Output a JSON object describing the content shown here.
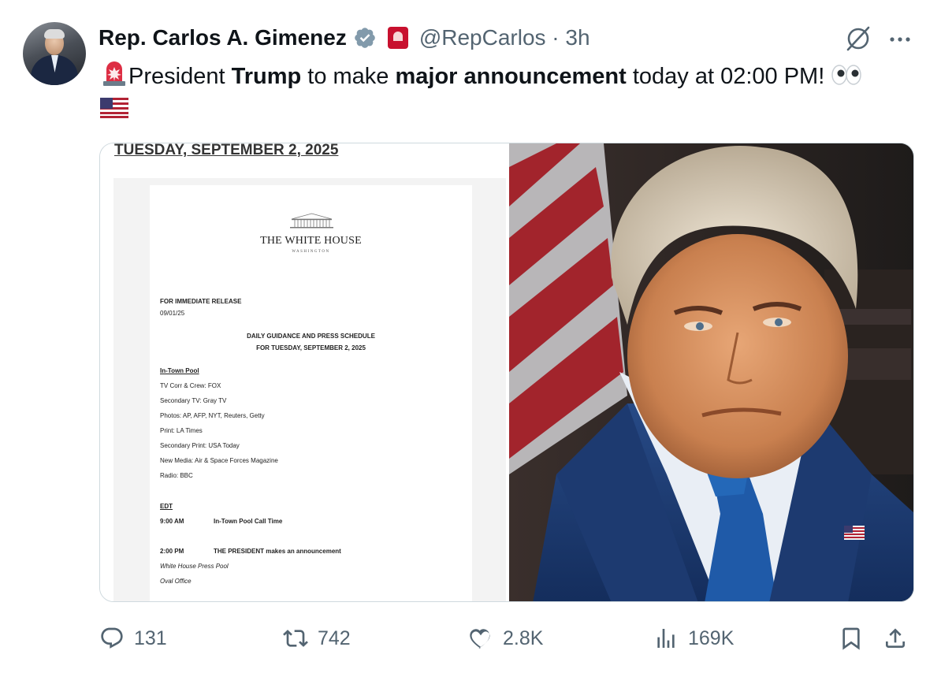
{
  "author": {
    "name": "Rep. Carlos A. Gimenez",
    "handle": "@RepCarlos",
    "time_sep": " · ",
    "time": "3h",
    "verified_icon": "verified-badge-icon",
    "affiliation_badge": "congress-badge-icon"
  },
  "tweet": {
    "pre": "President ",
    "bold1": "Trump",
    "mid": " to make ",
    "bold2": "major announcement",
    "post": " today at 02:00 PM! "
  },
  "document": {
    "date_header": "TUESDAY, SEPTEMBER 2, 2025",
    "org": "THE WHITE HOUSE",
    "org_sub": "WASHINGTON",
    "release": "FOR IMMEDIATE RELEASE",
    "release_date": "09/01/25",
    "schedule_title": "DAILY GUIDANCE AND PRESS SCHEDULE",
    "schedule_date": "FOR TUESDAY, SEPTEMBER 2, 2025",
    "pool_heading": "In-Town Pool",
    "pool_lines": [
      "TV Corr & Crew: FOX",
      "Secondary TV: Gray TV",
      "Photos: AP, AFP, NYT, Reuters, Getty",
      "Print: LA Times",
      "Secondary Print: USA Today",
      "New Media: Air & Space Forces Magazine",
      "Radio: BBC"
    ],
    "tz": "EDT",
    "event1_time": "9:00 AM",
    "event1_desc": "In-Town Pool Call Time",
    "event2_time": "2:00 PM",
    "event2_desc": "THE PRESIDENT makes an announcement",
    "event2_note1": "White House Press Pool",
    "event2_note2": "Oval Office"
  },
  "actions": {
    "replies": "131",
    "reposts": "742",
    "likes": "2.8K",
    "views": "169K"
  },
  "colors": {
    "text_primary": "#0f1419",
    "text_secondary": "#536471",
    "verified": "#829aab",
    "border": "#cfd9de"
  }
}
